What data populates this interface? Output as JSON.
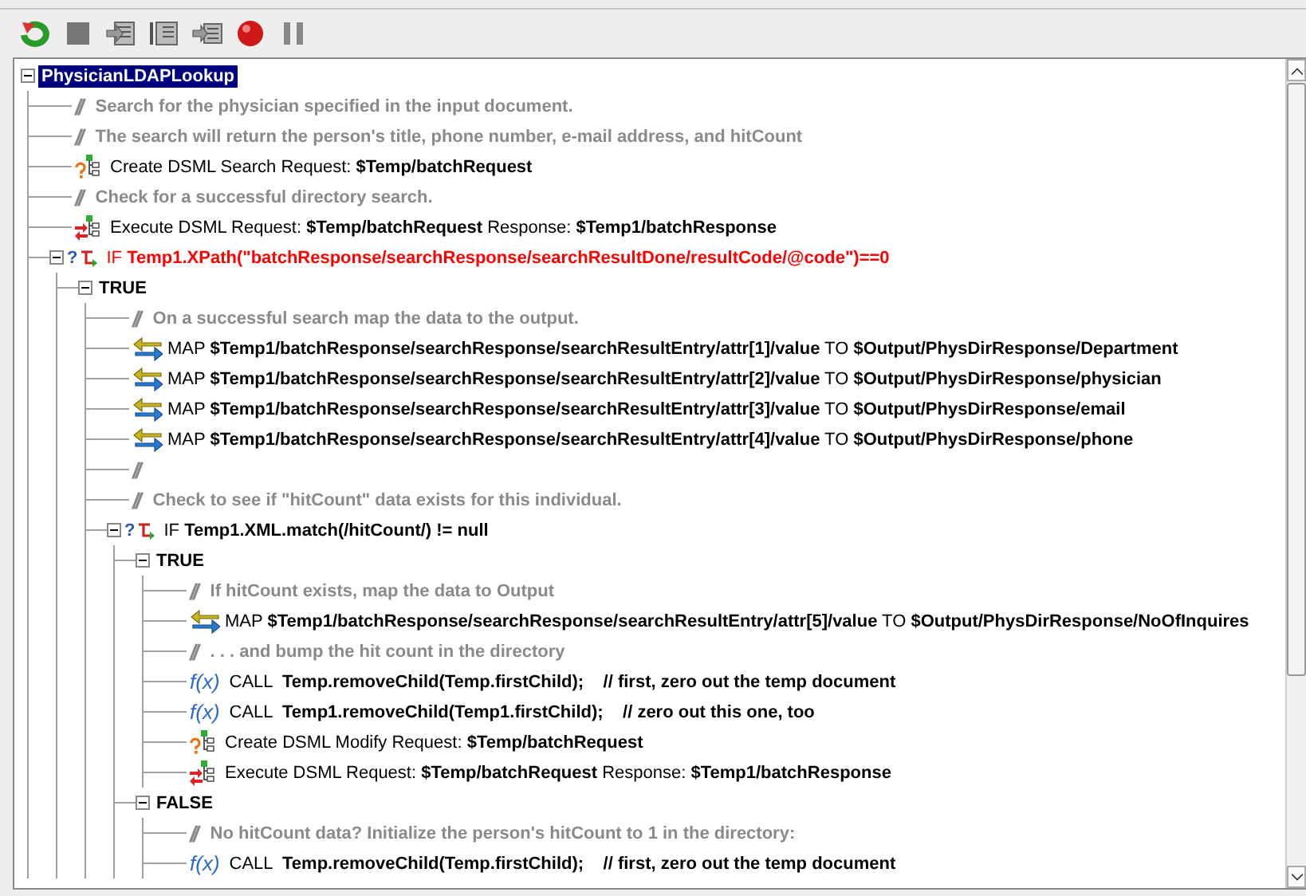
{
  "tree": {
    "kind": "root",
    "label": "PhysicianLDAPLookup",
    "selected": true,
    "expanded": true,
    "children": [
      {
        "kind": "comment",
        "glyph": "//",
        "label": "Search for the physician specified in the input document.",
        "selected": false
      },
      {
        "kind": "comment",
        "glyph": "//",
        "label": "The search will return the person's title, phone number, e-mail address, and hitCount",
        "selected": false
      },
      {
        "kind": "create",
        "label": "Create DSML Search Request: **$Temp/batchRequest**",
        "selected": false
      },
      {
        "kind": "comment",
        "glyph": "//",
        "label": "Check for a successful directory search.",
        "selected": false
      },
      {
        "kind": "execute",
        "label": "Execute DSML Request: **$Temp/batchRequest** Response: **$Temp1/batchResponse**",
        "selected": false
      },
      {
        "kind": "if",
        "glyph": "?",
        "color": "#ff0000",
        "label": "IF **Temp1.XPath(\"batchResponse/searchResponse/searchResultDone/resultCode/@code\")==0**",
        "selected": false,
        "expanded": true,
        "children": [
          {
            "kind": "branch",
            "label": "TRUE",
            "selected": false,
            "expanded": true,
            "children": [
              {
                "kind": "comment",
                "glyph": "//",
                "label": "On a successful search map the data to the output.",
                "selected": false
              },
              {
                "kind": "map",
                "label": "MAP **$Temp1/batchResponse/searchResponse/searchResultEntry/attr[1]/value** TO **$Output/PhysDirResponse/Department**",
                "selected": false
              },
              {
                "kind": "map",
                "label": "MAP **$Temp1/batchResponse/searchResponse/searchResultEntry/attr[2]/value** TO **$Output/PhysDirResponse/physician**",
                "selected": false
              },
              {
                "kind": "map",
                "label": "MAP **$Temp1/batchResponse/searchResponse/searchResultEntry/attr[3]/value** TO **$Output/PhysDirResponse/email**",
                "selected": false
              },
              {
                "kind": "map",
                "label": "MAP **$Temp1/batchResponse/searchResponse/searchResultEntry/attr[4]/value** TO **$Output/PhysDirResponse/phone**",
                "selected": false
              },
              {
                "kind": "comment",
                "glyph": "//",
                "selected": false
              },
              {
                "kind": "comment",
                "glyph": "//",
                "label": "Check to see if \"hitCount\" data exists for this individual.",
                "selected": false
              },
              {
                "kind": "if",
                "glyph": "?",
                "color": "#000000",
                "label": "IF **Temp1.XML.match(/hitCount/) != null**",
                "selected": false,
                "expanded": true,
                "children": [
                  {
                    "kind": "branch",
                    "label": "TRUE",
                    "selected": false,
                    "expanded": true,
                    "children": [
                      {
                        "kind": "comment",
                        "glyph": "//",
                        "label": "If hitCount exists, map the data to Output",
                        "selected": false
                      },
                      {
                        "kind": "map",
                        "label": "MAP **$Temp1/batchResponse/searchResponse/searchResultEntry/attr[5]/value** TO **$Output/PhysDirResponse/NoOfInquires**",
                        "selected": false
                      },
                      {
                        "kind": "comment",
                        "glyph": "//",
                        "label": ". . . and bump the hit count in the directory",
                        "selected": false
                      },
                      {
                        "kind": "call",
                        "glyph": "f(x)",
                        "label": "CALL  **Temp.removeChild(Temp.firstChild);    // first, zero out the temp document**",
                        "selected": false
                      },
                      {
                        "kind": "call",
                        "glyph": "f(x)",
                        "label": "CALL  **Temp1.removeChild(Temp1.firstChild);    // zero out this one, too**",
                        "selected": false
                      },
                      {
                        "kind": "create",
                        "label": "Create DSML Modify Request: **$Temp/batchRequest**",
                        "selected": false
                      },
                      {
                        "kind": "execute",
                        "label": "Execute DSML Request: **$Temp/batchRequest** Response: **$Temp1/batchResponse**",
                        "selected": false
                      }
                    ]
                  },
                  {
                    "kind": "branch",
                    "label": "FALSE",
                    "selected": false,
                    "expanded": true,
                    "children": [
                      {
                        "kind": "comment",
                        "glyph": "//",
                        "label": "No hitCount data? Initialize the person's hitCount to 1 in the directory:",
                        "selected": false
                      },
                      {
                        "kind": "call",
                        "glyph": "f(x)",
                        "label": "CALL  **Temp.removeChild(Temp.firstChild);    // first, zero out the temp document**",
                        "selected": false
                      }
                    ]
                  }
                ]
              }
            ]
          }
        ]
      }
    ]
  }
}
